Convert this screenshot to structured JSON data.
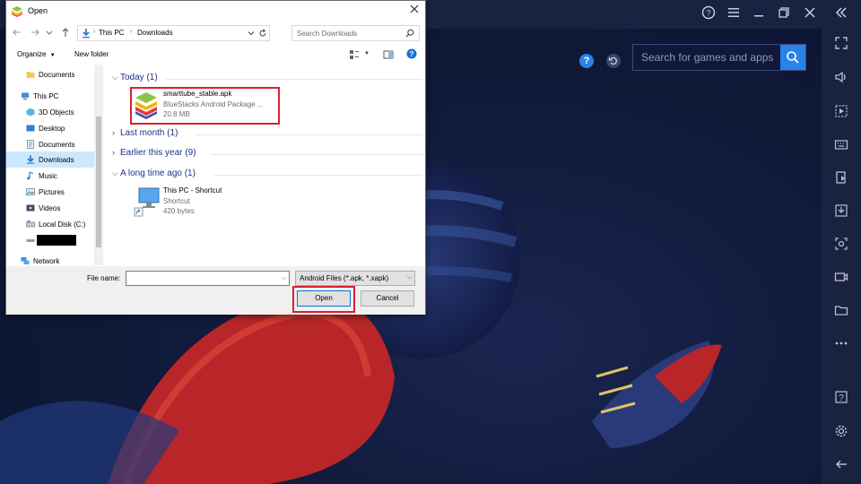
{
  "bluestacks": {
    "search_placeholder": "Search for games and apps",
    "icons": {
      "top": [
        "help-icon",
        "menu-icon",
        "minimize-icon",
        "restore-icon",
        "close-icon",
        "collapse-sidebar-icon"
      ],
      "sidebar": [
        "fullscreen-icon",
        "volume-icon",
        "screen-record-icon",
        "keyboard-icon",
        "install-apk-icon",
        "import-icon",
        "screenshot-icon",
        "video-icon",
        "folder-icon",
        "more-icon",
        "help-icon",
        "settings-icon",
        "back-icon"
      ]
    },
    "colors": {
      "topbar": "#1a2242",
      "search_button": "#2a83e6"
    }
  },
  "dialog": {
    "title": "Open",
    "address": {
      "crumbs": [
        "This PC",
        "Downloads"
      ]
    },
    "search_placeholder": "Search Downloads",
    "toolbar": {
      "organize": "Organize",
      "new_folder": "New folder"
    },
    "nav_items": [
      {
        "label": "Documents",
        "icon": "folder-icon"
      },
      {
        "label": "This PC",
        "icon": "computer-icon"
      },
      {
        "label": "3D Objects",
        "icon": "3d-objects-icon"
      },
      {
        "label": "Desktop",
        "icon": "desktop-icon"
      },
      {
        "label": "Documents",
        "icon": "documents-icon"
      },
      {
        "label": "Downloads",
        "icon": "downloads-icon",
        "selected": true
      },
      {
        "label": "Music",
        "icon": "music-icon"
      },
      {
        "label": "Pictures",
        "icon": "pictures-icon"
      },
      {
        "label": "Videos",
        "icon": "videos-icon"
      },
      {
        "label": "Local Disk (C:)",
        "icon": "drive-icon"
      },
      {
        "label": "",
        "icon": "drive-icon",
        "redacted": true
      },
      {
        "label": "Network",
        "icon": "network-icon"
      }
    ],
    "groups": [
      {
        "label": "Today (1)",
        "expanded": true
      },
      {
        "label": "Last month (1)",
        "expanded": false
      },
      {
        "label": "Earlier this year (9)",
        "expanded": false
      },
      {
        "label": "A long time ago (1)",
        "expanded": true
      }
    ],
    "files": [
      {
        "name": "smarttube_stable.apk",
        "type": "BlueStacks Android Package ...",
        "size": "20.8 MB",
        "icon": "bluestacks-apk-icon"
      },
      {
        "name": "This PC - Shortcut",
        "type": "Shortcut",
        "size": "420 bytes",
        "icon": "shortcut-icon"
      }
    ],
    "file_name_label": "File name:",
    "file_name_value": "",
    "file_type": "Android Files (*.apk, *.xapk)",
    "open_label": "Open",
    "cancel_label": "Cancel",
    "colors": {
      "selection": "#cce8ff",
      "highlight": "#d9202e",
      "group_header": "#1e3287"
    }
  }
}
